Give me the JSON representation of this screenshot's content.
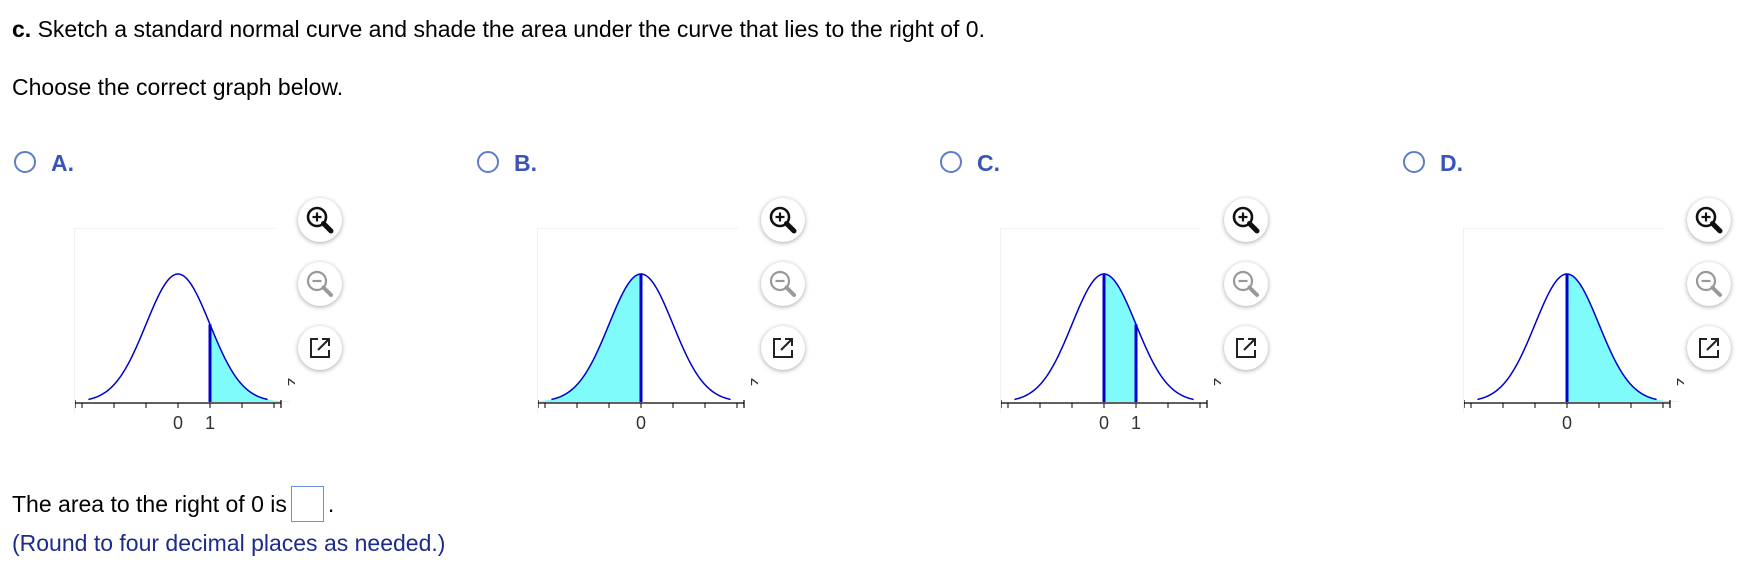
{
  "question": {
    "part_label": "c.",
    "text": "Sketch a standard normal curve and shade the area under the curve that lies to the right of 0."
  },
  "instruction": "Choose the correct graph below.",
  "options": [
    {
      "letter": "A.",
      "tick_labels": [
        "0",
        "1"
      ],
      "shade_from": 1,
      "shade_to": 3.5,
      "lines_at": [
        1
      ],
      "axis_label": "z"
    },
    {
      "letter": "B.",
      "tick_labels": [
        "0"
      ],
      "shade_from": -3.5,
      "shade_to": 0,
      "lines_at": [
        0
      ],
      "axis_label": "z"
    },
    {
      "letter": "C.",
      "tick_labels": [
        "0",
        "1"
      ],
      "shade_from": 0,
      "shade_to": 1,
      "lines_at": [
        0,
        1
      ],
      "axis_label": "z"
    },
    {
      "letter": "D.",
      "tick_labels": [
        "0"
      ],
      "shade_from": 0,
      "shade_to": 3.5,
      "lines_at": [
        0
      ],
      "axis_label": "z"
    }
  ],
  "tools": [
    "zoom-in-icon",
    "zoom-out-icon",
    "open-external-icon"
  ],
  "answer": {
    "prefix": "The area to the right of 0 is",
    "suffix": ".",
    "value": ""
  },
  "hint": "(Round to four decimal places as needed.)",
  "colors": {
    "curve": "#0000cc",
    "shade": "#7ffbfb",
    "option_letter": "#3a55b7",
    "hint": "#1c2c8c"
  }
}
